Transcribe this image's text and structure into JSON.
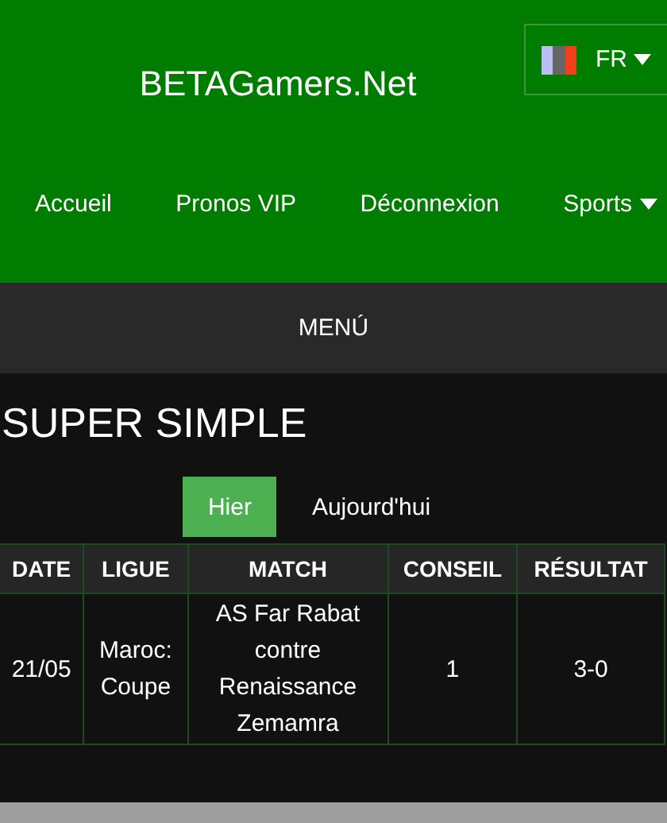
{
  "header": {
    "logo": "BETAGamers.Net",
    "language": {
      "label": "FR"
    }
  },
  "nav": [
    {
      "label": "Accueil",
      "dropdown": false
    },
    {
      "label": "Pronos VIP",
      "dropdown": false
    },
    {
      "label": "Déconnexion",
      "dropdown": false
    },
    {
      "label": "Sports",
      "dropdown": true
    }
  ],
  "menu_bar": {
    "label": "MENÚ"
  },
  "title": "SUPER SIMPLE",
  "tabs": [
    {
      "label": "Hier",
      "selected": true
    },
    {
      "label": "Aujourd'hui",
      "selected": false
    }
  ],
  "table": {
    "columns": [
      "DATE",
      "LIGUE",
      "MATCH",
      "CONSEIL",
      "RÉSULTAT"
    ],
    "rows": [
      [
        "21/05",
        "Maroc: Coupe",
        "AS Far Rabat contre Renaissance Zemamra",
        "1",
        "3-0"
      ]
    ]
  }
}
